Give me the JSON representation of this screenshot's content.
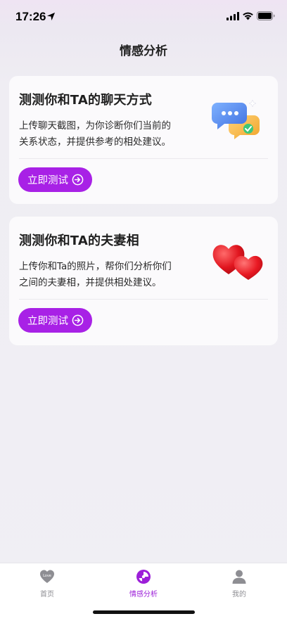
{
  "status_bar": {
    "time": "17:26"
  },
  "page_title": "情感分析",
  "cards": [
    {
      "title": "测测你和TA的聊天方式",
      "desc_line1": "上传聊天截图，为你诊断你们当前的",
      "desc_line2": "关系状态，并提供参考的相处建议。",
      "button_label": "立即测试",
      "illustration": "chat-bubbles-icon"
    },
    {
      "title": "测测你和TA的夫妻相",
      "desc_line1": "上传你和Ta的照片，帮你们分析你们",
      "desc_line2": "之间的夫妻相，并提供相处建议。",
      "button_label": "立即测试",
      "illustration": "hearts-icon"
    }
  ],
  "tabs": [
    {
      "label": "首页",
      "icon": "love-heart-icon",
      "heart_text": "Love"
    },
    {
      "label": "情感分析",
      "icon": "analysis-icon",
      "active": true
    },
    {
      "label": "我的",
      "icon": "user-icon"
    }
  ],
  "colors": {
    "accent": "#a821e6",
    "active_tab": "#9c1fd8",
    "inactive_tab": "#8e8e93"
  }
}
